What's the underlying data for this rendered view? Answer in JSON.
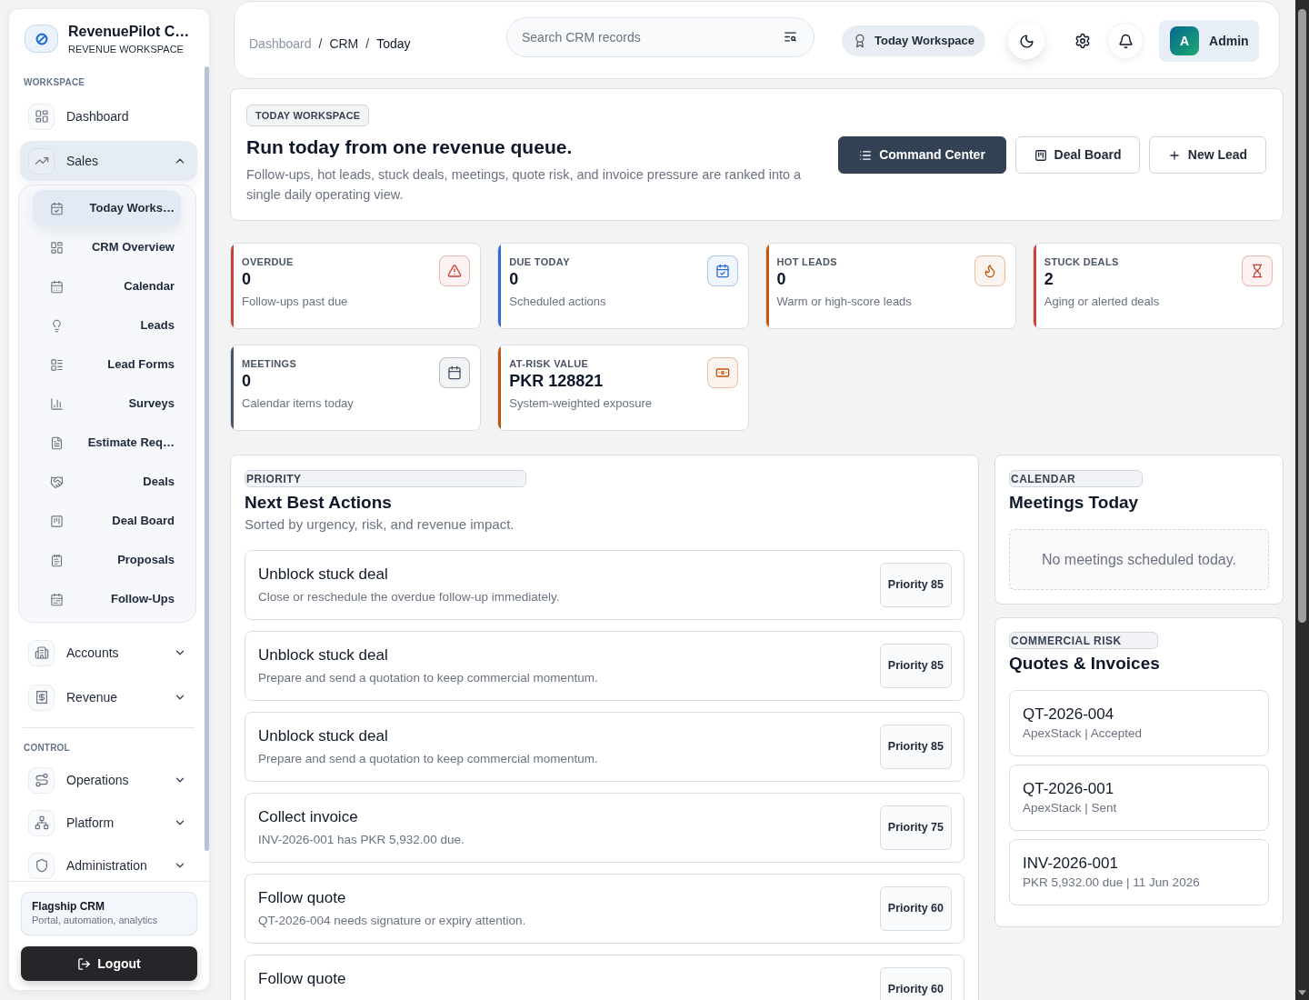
{
  "sidebar": {
    "brand": {
      "name": "RevenuePilot C…",
      "subtitle": "REVENUE WORKSPACE"
    },
    "sections": [
      {
        "label": "WORKSPACE",
        "items": [
          {
            "label": "Dashboard",
            "kind": "link",
            "selected": false
          },
          {
            "label": "Sales",
            "kind": "group",
            "selected": true,
            "expanded": true,
            "children": [
              {
                "label": "Today Works…",
                "selected": true
              },
              {
                "label": "CRM Overview",
                "selected": false
              },
              {
                "label": "Calendar",
                "selected": false
              },
              {
                "label": "Leads",
                "selected": false
              },
              {
                "label": "Lead Forms",
                "selected": false
              },
              {
                "label": "Surveys",
                "selected": false
              },
              {
                "label": "Estimate Req…",
                "selected": false
              },
              {
                "label": "Deals",
                "selected": false
              },
              {
                "label": "Deal Board",
                "selected": false
              },
              {
                "label": "Proposals",
                "selected": false
              },
              {
                "label": "Follow-Ups",
                "selected": false
              }
            ]
          },
          {
            "label": "Accounts",
            "kind": "group",
            "selected": false,
            "expanded": false
          },
          {
            "label": "Revenue",
            "kind": "group",
            "selected": false,
            "expanded": false
          }
        ]
      },
      {
        "label": "CONTROL",
        "items": [
          {
            "label": "Operations",
            "kind": "group",
            "selected": false,
            "expanded": false
          },
          {
            "label": "Platform",
            "kind": "group",
            "selected": false,
            "expanded": false
          },
          {
            "label": "Administration",
            "kind": "group",
            "selected": false,
            "expanded": false
          }
        ]
      }
    ],
    "promo": {
      "title": "Flagship CRM",
      "subtitle": "Portal, automation, analytics"
    },
    "logout": {
      "label": "Logout"
    }
  },
  "header": {
    "breadcrumb": [
      {
        "label": "Dashboard",
        "kind": "link"
      },
      {
        "label": "/",
        "kind": "separator"
      },
      {
        "label": "CRM",
        "kind": "section"
      },
      {
        "label": "/",
        "kind": "separator"
      },
      {
        "label": "Today",
        "kind": "current"
      }
    ],
    "search": {
      "placeholder": "Search CRM records"
    },
    "workspace_badge": "Today Workspace",
    "user": {
      "initial": "A",
      "name": "Admin"
    }
  },
  "hero": {
    "badge": "TODAY WORKSPACE",
    "title": "Run today from one revenue queue.",
    "description": "Follow-ups, hot leads, stuck deals, meetings, quote risk, and invoice pressure are ranked into a single daily operating view.",
    "actions": [
      {
        "label": "Command Center",
        "kind": "primary"
      },
      {
        "label": "Deal Board",
        "kind": "secondary"
      },
      {
        "label": "New Lead",
        "kind": "secondary"
      }
    ]
  },
  "stats": [
    {
      "label": "OVERDUE",
      "value": "0",
      "caption": "Follow-ups past due",
      "color": "#c8423a"
    },
    {
      "label": "DUE TODAY",
      "value": "0",
      "caption": "Scheduled actions",
      "color": "#2f6bd6"
    },
    {
      "label": "HOT LEADS",
      "value": "0",
      "caption": "Warm or high-score leads",
      "color": "#c2570c"
    },
    {
      "label": "STUCK DEALS",
      "value": "2",
      "caption": "Aging or alerted deals",
      "color": "#c8423a"
    },
    {
      "label": "MEETINGS",
      "value": "0",
      "caption": "Calendar items today",
      "color": "#475569"
    },
    {
      "label": "AT-RISK VALUE",
      "value": "PKR 128821",
      "caption": "System-weighted exposure",
      "color": "#c2570c"
    }
  ],
  "priority": {
    "tag": "PRIORITY",
    "title": "Next Best Actions",
    "subtitle": "Sorted by urgency, risk, and revenue impact.",
    "actions": [
      {
        "title": "Unblock stuck deal",
        "description": "Close or reschedule the overdue follow-up immediately.",
        "priority": "Priority 85"
      },
      {
        "title": "Unblock stuck deal",
        "description": "Prepare and send a quotation to keep commercial momentum.",
        "priority": "Priority 85"
      },
      {
        "title": "Unblock stuck deal",
        "description": "Prepare and send a quotation to keep commercial momentum.",
        "priority": "Priority 85"
      },
      {
        "title": "Collect invoice",
        "description": "INV-2026-001 has PKR 5,932.00 due.",
        "priority": "Priority 75"
      },
      {
        "title": "Follow quote",
        "description": "QT-2026-004 needs signature or expiry attention.",
        "priority": "Priority 60"
      },
      {
        "title": "Follow quote",
        "priority": "Priority 60"
      }
    ]
  },
  "calendar": {
    "tag": "CALENDAR",
    "title": "Meetings Today",
    "empty_message": "No meetings scheduled today."
  },
  "commercial_risk": {
    "tag": "COMMERCIAL RISK",
    "title": "Quotes & Invoices",
    "items": [
      {
        "id": "QT-2026-004",
        "details": "ApexStack | Accepted"
      },
      {
        "id": "QT-2026-001",
        "details": "ApexStack | Sent"
      },
      {
        "id": "INV-2026-001",
        "details": "PKR 5,932.00 due | 11 Jun 2026"
      }
    ]
  }
}
